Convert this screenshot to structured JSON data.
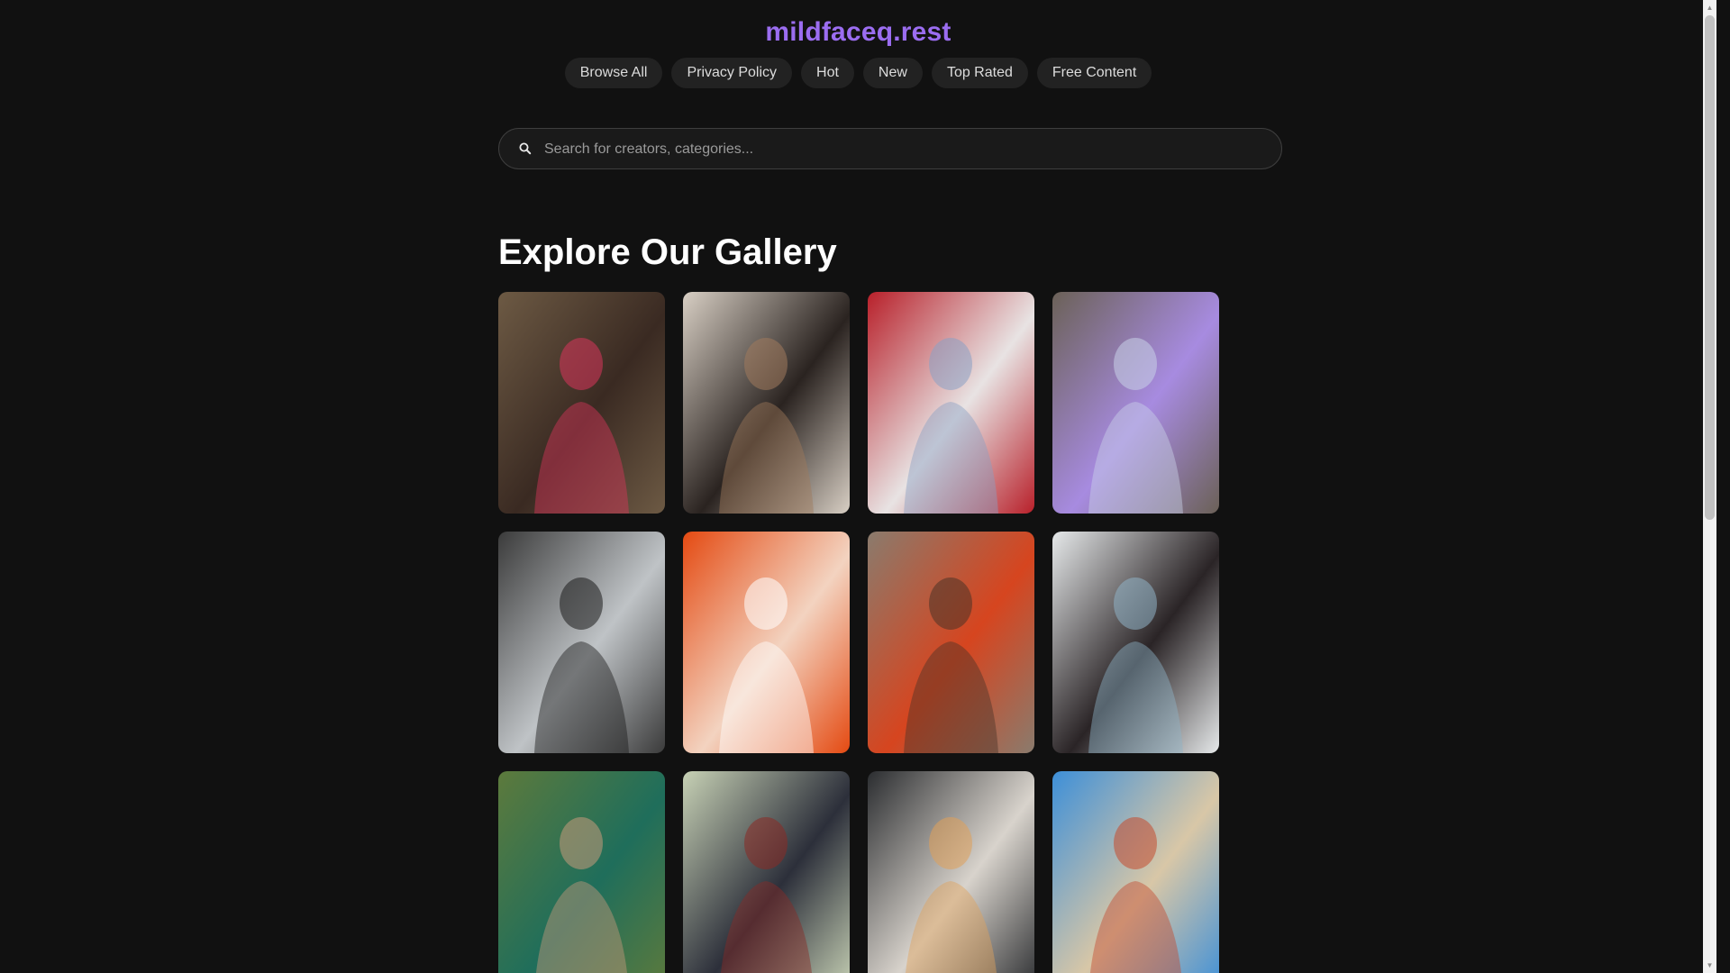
{
  "site": {
    "title": "mildfaceq.rest"
  },
  "nav": {
    "items": [
      {
        "label": "Browse All"
      },
      {
        "label": "Privacy Policy"
      },
      {
        "label": "Hot"
      },
      {
        "label": "New"
      },
      {
        "label": "Top Rated"
      },
      {
        "label": "Free Content"
      }
    ]
  },
  "search": {
    "placeholder": "Search for creators, categories...",
    "value": "",
    "icon": "search-icon"
  },
  "gallery": {
    "title": "Explore Our Gallery",
    "tiles": [
      {
        "thumb": "photo-thumbnail",
        "palette": [
          "#6d5a44",
          "#3a2a22",
          "#d9355b"
        ]
      },
      {
        "thumb": "photo-thumbnail",
        "palette": [
          "#d8cfc4",
          "#2a2320",
          "#a07a5c"
        ]
      },
      {
        "thumb": "photo-thumbnail",
        "palette": [
          "#b8202a",
          "#e8e3e3",
          "#8aa0c4"
        ]
      },
      {
        "thumb": "photo-thumbnail",
        "palette": [
          "#6b6157",
          "#a78be0",
          "#c9d2e8"
        ]
      },
      {
        "thumb": "photo-thumbnail",
        "palette": [
          "#3b3b3b",
          "#bfc3c6",
          "#1b1b1b"
        ]
      },
      {
        "thumb": "photo-thumbnail",
        "palette": [
          "#e44a12",
          "#f3d3c0",
          "#ffffff"
        ]
      },
      {
        "thumb": "photo-thumbnail",
        "palette": [
          "#8a7b6d",
          "#d6451f",
          "#4a3327"
        ]
      },
      {
        "thumb": "photo-thumbnail",
        "palette": [
          "#e6e9ea",
          "#2a2426",
          "#8fb3c7"
        ]
      },
      {
        "thumb": "photo-thumbnail",
        "palette": [
          "#5d7a3c",
          "#1f6e5b",
          "#c79a7c"
        ]
      },
      {
        "thumb": "photo-thumbnail",
        "palette": [
          "#c7d1b5",
          "#2c2f3a",
          "#8a2a25"
        ]
      },
      {
        "thumb": "photo-thumbnail",
        "palette": [
          "#2b2d30",
          "#d8d3cc",
          "#e0a15a"
        ]
      },
      {
        "thumb": "photo-thumbnail",
        "palette": [
          "#3d8fd8",
          "#d8c7a7",
          "#c44a2e"
        ]
      }
    ]
  }
}
